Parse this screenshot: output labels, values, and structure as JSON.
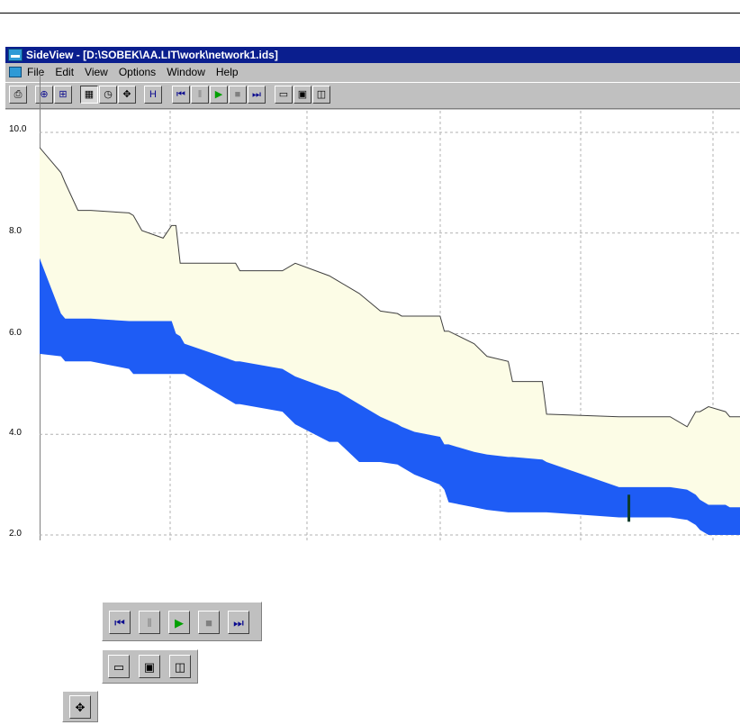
{
  "window": {
    "title": "SideView - [D:\\SOBEK\\AA.LIT\\work\\network1.ids]"
  },
  "menu": [
    "File",
    "Edit",
    "View",
    "Options",
    "Window",
    "Help"
  ],
  "toolbar": {
    "buttons": [
      {
        "name": "print-icon",
        "glyph": "⎙"
      },
      {
        "name": "zoom-icon",
        "glyph": "⊕"
      },
      {
        "name": "zoom-fit-icon",
        "glyph": "⊞"
      },
      {
        "name": "grid-icon",
        "glyph": "▦"
      },
      {
        "name": "clock-icon",
        "glyph": "◷"
      },
      {
        "name": "network-icon",
        "glyph": "✥"
      },
      {
        "name": "his-icon",
        "glyph": "H"
      },
      {
        "name": "go-to-start-icon",
        "glyph": "⏮"
      },
      {
        "name": "pause-icon",
        "glyph": "‖"
      },
      {
        "name": "play-icon",
        "glyph": "▶"
      },
      {
        "name": "stop-icon",
        "glyph": "■"
      },
      {
        "name": "go-to-end-icon",
        "glyph": "⏭"
      },
      {
        "name": "open-icon",
        "glyph": "▭"
      },
      {
        "name": "folder-icon",
        "glyph": "▣"
      },
      {
        "name": "save-icon",
        "glyph": "◫"
      }
    ]
  },
  "chart_data": {
    "type": "area",
    "ylim": [
      2.0,
      10.0
    ],
    "yticks": [
      "10.0",
      "8.0",
      "6.0",
      "4.0",
      "2.0"
    ],
    "grid": true,
    "colors": {
      "ground": "#fcfce6",
      "ground_stroke": "#404040",
      "water": "#1e5cf5",
      "grid": "#b0b0b0"
    },
    "series": [
      {
        "x": [
          0,
          25,
          30,
          45,
          60,
          105,
          110,
          120,
          145,
          155,
          160,
          165,
          170,
          230,
          235,
          285,
          300,
          340,
          350,
          375,
          400,
          420,
          425,
          440,
          470,
          475,
          480,
          510,
          525,
          550,
          555,
          590,
          595,
          680,
          740,
          760,
          770,
          775,
          785,
          805,
          810,
          822
        ],
        "values": [
          9.7,
          9.2,
          9.0,
          8.45,
          8.45,
          8.4,
          8.35,
          8.05,
          7.9,
          8.15,
          8.15,
          7.4,
          7.4,
          7.4,
          7.25,
          7.25,
          7.4,
          7.15,
          7.05,
          6.8,
          6.45,
          6.4,
          6.35,
          6.35,
          6.35,
          6.05,
          6.05,
          5.8,
          5.55,
          5.45,
          5.05,
          5.05,
          4.4,
          4.35,
          4.35,
          4.15,
          4.45,
          4.45,
          4.55,
          4.45,
          4.35,
          4.35
        ]
      },
      {
        "x": [
          0,
          25,
          30,
          45,
          60,
          105,
          110,
          120,
          145,
          155,
          160,
          165,
          170,
          230,
          235,
          285,
          300,
          340,
          350,
          375,
          400,
          420,
          425,
          440,
          470,
          475,
          480,
          510,
          525,
          550,
          555,
          590,
          595,
          680,
          740,
          760,
          770,
          775,
          785,
          805,
          810,
          822
        ],
        "values": [
          7.5,
          6.4,
          6.3,
          6.3,
          6.3,
          6.25,
          6.25,
          6.25,
          6.25,
          6.25,
          6.0,
          5.95,
          5.8,
          5.45,
          5.45,
          5.3,
          5.15,
          4.9,
          4.85,
          4.6,
          4.35,
          4.2,
          4.15,
          4.05,
          3.95,
          3.8,
          3.8,
          3.65,
          3.6,
          3.55,
          3.55,
          3.5,
          3.45,
          2.95,
          2.95,
          2.9,
          2.8,
          2.7,
          2.6,
          2.6,
          2.55,
          2.55
        ]
      },
      {
        "x": [
          0,
          25,
          30,
          45,
          60,
          105,
          110,
          120,
          145,
          155,
          160,
          165,
          170,
          230,
          235,
          285,
          300,
          340,
          350,
          375,
          400,
          420,
          425,
          440,
          470,
          475,
          480,
          510,
          525,
          550,
          555,
          590,
          595,
          680,
          740,
          760,
          770,
          775,
          785,
          805,
          810,
          822
        ],
        "values": [
          5.6,
          5.55,
          5.45,
          5.45,
          5.45,
          5.3,
          5.2,
          5.2,
          5.2,
          5.2,
          5.2,
          5.2,
          5.2,
          4.6,
          4.6,
          4.45,
          4.2,
          3.85,
          3.85,
          3.45,
          3.45,
          3.4,
          3.35,
          3.2,
          3.0,
          2.9,
          2.65,
          2.55,
          2.5,
          2.45,
          2.45,
          2.45,
          2.45,
          2.35,
          2.35,
          2.3,
          2.2,
          2.1,
          2.0,
          2.0,
          2.0,
          2.0
        ]
      }
    ]
  }
}
